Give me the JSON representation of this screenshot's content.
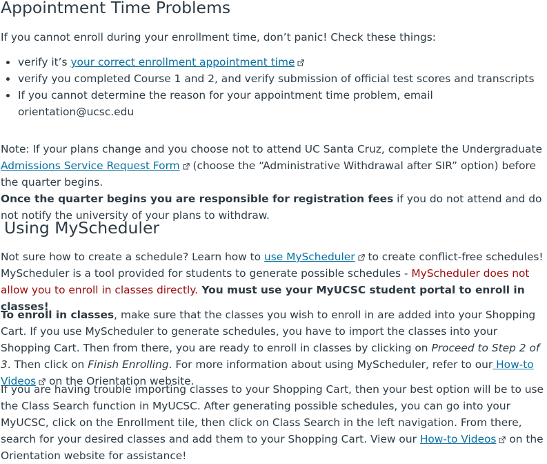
{
  "section1": {
    "heading": "Appointment Time Problems",
    "intro": "If you cannot enroll during your enrollment time, don’t panic! Check these things:",
    "bullets": {
      "b1_prefix": "verify it’s ",
      "b1_link": "your correct enrollment appointment time",
      "b2": "verify you completed Course 1 and 2, and verify submission of official test scores and transcripts",
      "b3": "If you cannot determine the reason for your appointment time problem, email orientation@ucsc.edu"
    },
    "note_prefix": "Note: If your plans change and you choose not to attend UC Santa Cruz, complete the Undergraduate ",
    "note_link": "Admissions Service Request Form",
    "note_suffix": " (choose the “Administrative Withdrawal after SIR” option) before the quarter begins.",
    "note_bold": "Once the quarter begins you are responsible for registration fees",
    "note_end": " if you do not attend and do not notify the university of your plans to withdraw."
  },
  "section2": {
    "heading": "Using MyScheduler",
    "p1_prefix": "Not sure how to create a schedule? Learn how to ",
    "p1_link": "use MyScheduler",
    "p1_suffix": " to create conflict-free schedules!",
    "p1_line2": "MyScheduler is a tool provided for students to generate possible schedules - ",
    "p1_red": "MyScheduler does not allow you to enroll in classes directly.",
    "p1_bold": " You must use your MyUCSC student portal to enroll in classes!",
    "p2_bold": "To enroll in classes",
    "p2_text1": ", make sure that the classes you wish to enroll in are added into your Shopping Cart. If you use MyScheduler to generate schedules, you have to import the classes into your Shopping Cart. Then from there, you are ready to enroll in classes by clicking on ",
    "p2_italic1": "Proceed to Step 2 of 3",
    "p2_text2": ". Then click on ",
    "p2_italic2": "Finish Enrolling",
    "p2_text3": ". For more information about using MyScheduler, refer to our",
    "p2_link": " How-to Videos",
    "p2_text4": " on the Orientation website.",
    "p3_text1": "If you are having trouble importing classes to your Shopping Cart, then your best option will be to use the Class Search function in MyUCSC. After generating possible schedules, you can go into your MyUCSC, click on the Enrollment tile, then click on Class Search in the left navigation. From there, search for your desired classes and add them to your Shopping Cart. View our ",
    "p3_link": "How-to Videos",
    "p3_text2": " on the Orientation website for assistance!"
  },
  "icons": {
    "external_link": "external-link-icon"
  },
  "colors": {
    "text": "#2d3b45",
    "link": "#0770a3",
    "warning": "#9b0a0a"
  }
}
